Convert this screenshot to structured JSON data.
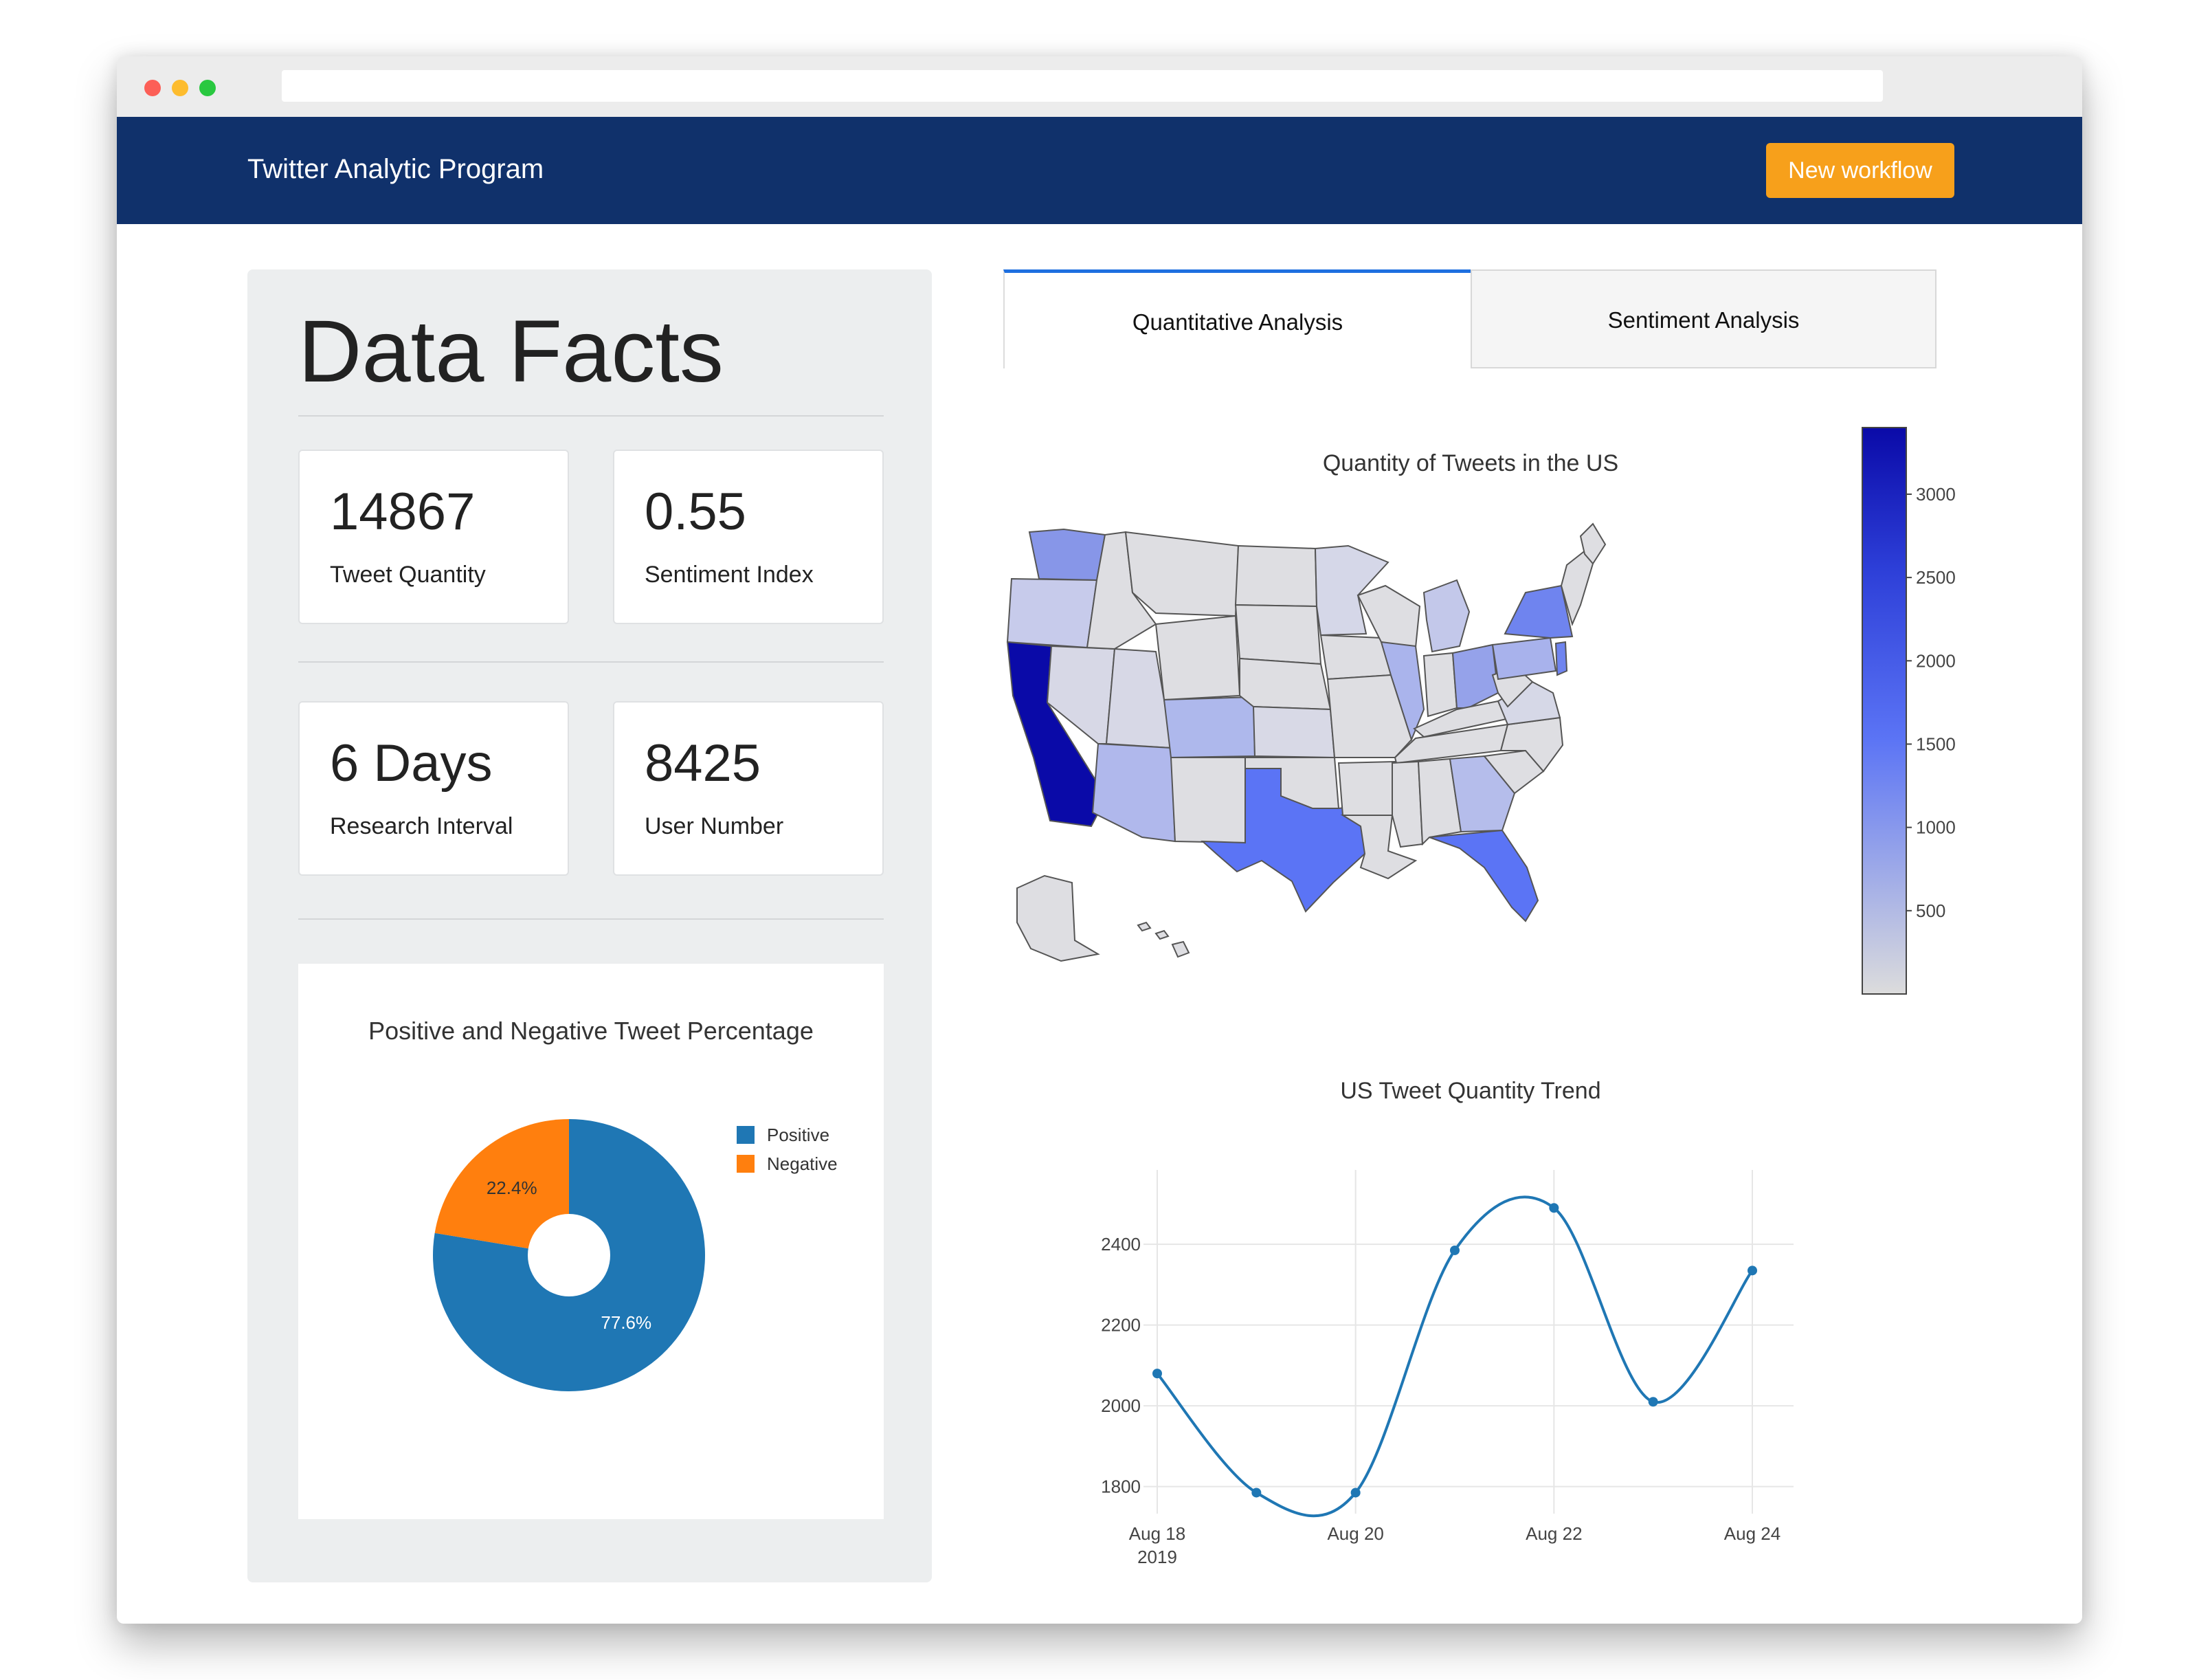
{
  "app": {
    "title": "Twitter Analytic Program",
    "new_workflow_label": "New workflow"
  },
  "facts": {
    "heading": "Data Facts",
    "cards": [
      {
        "value": "14867",
        "label": "Tweet Quantity"
      },
      {
        "value": "0.55",
        "label": "Sentiment Index"
      },
      {
        "value": "6 Days",
        "label": "Research Interval"
      },
      {
        "value": "8425",
        "label": "User Number"
      }
    ]
  },
  "tabs": [
    {
      "label": "Quantitative Analysis",
      "active": true
    },
    {
      "label": "Sentiment Analysis",
      "active": false
    }
  ],
  "colors": {
    "navbar": "#10316b",
    "accent_button": "#f7a01b",
    "active_tab": "#1e6fe0",
    "positive": "#1f77b4",
    "negative": "#ff7f0e",
    "map_high": "#0a0aa8",
    "map_low": "#dcdcdc"
  },
  "chart_data": [
    {
      "type": "pie",
      "title": "Positive and Negative Tweet Percentage",
      "labels": [
        "Positive",
        "Negative"
      ],
      "values": [
        77.6,
        22.4
      ],
      "value_labels": [
        "77.6%",
        "22.4%"
      ],
      "colors": [
        "#1f77b4",
        "#ff7f0e"
      ],
      "hole": 0.3,
      "legend": "top-right"
    },
    {
      "type": "choropleth",
      "title": "Quantity of Tweets in the US",
      "colorbar_ticks": [
        "3000",
        "2500",
        "2000",
        "1500",
        "1000",
        "500"
      ],
      "colorbar_range": [
        0,
        3400
      ],
      "regions": [
        {
          "state": "California",
          "value": 3400
        },
        {
          "state": "Texas",
          "value": 1500
        },
        {
          "state": "Florida",
          "value": 1450
        },
        {
          "state": "New York",
          "value": 1400
        },
        {
          "state": "Washington",
          "value": 900
        },
        {
          "state": "Colorado",
          "value": 800
        },
        {
          "state": "Illinois",
          "value": 850
        },
        {
          "state": "Arizona",
          "value": 700
        },
        {
          "state": "Ohio",
          "value": 850
        },
        {
          "state": "Pennsylvania",
          "value": 800
        },
        {
          "state": "Georgia",
          "value": 650
        },
        {
          "state": "New Jersey",
          "value": 1000
        }
      ]
    },
    {
      "type": "line",
      "title": "US Tweet Quantity Trend",
      "x": [
        "2019-08-18",
        "2019-08-19",
        "2019-08-20",
        "2019-08-21",
        "2019-08-22",
        "2019-08-23",
        "2019-08-24"
      ],
      "y": [
        2080,
        1785,
        1785,
        2385,
        2490,
        2010,
        2335
      ],
      "x_tick_labels": [
        "Aug 18",
        "Aug 20",
        "Aug 22",
        "Aug 24"
      ],
      "x_tick_sublabel": "2019",
      "y_ticks": [
        "2400",
        "2200",
        "2000",
        "1800"
      ],
      "ylim": [
        1750,
        2550
      ],
      "grid": true,
      "line_shape": "spline"
    }
  ]
}
